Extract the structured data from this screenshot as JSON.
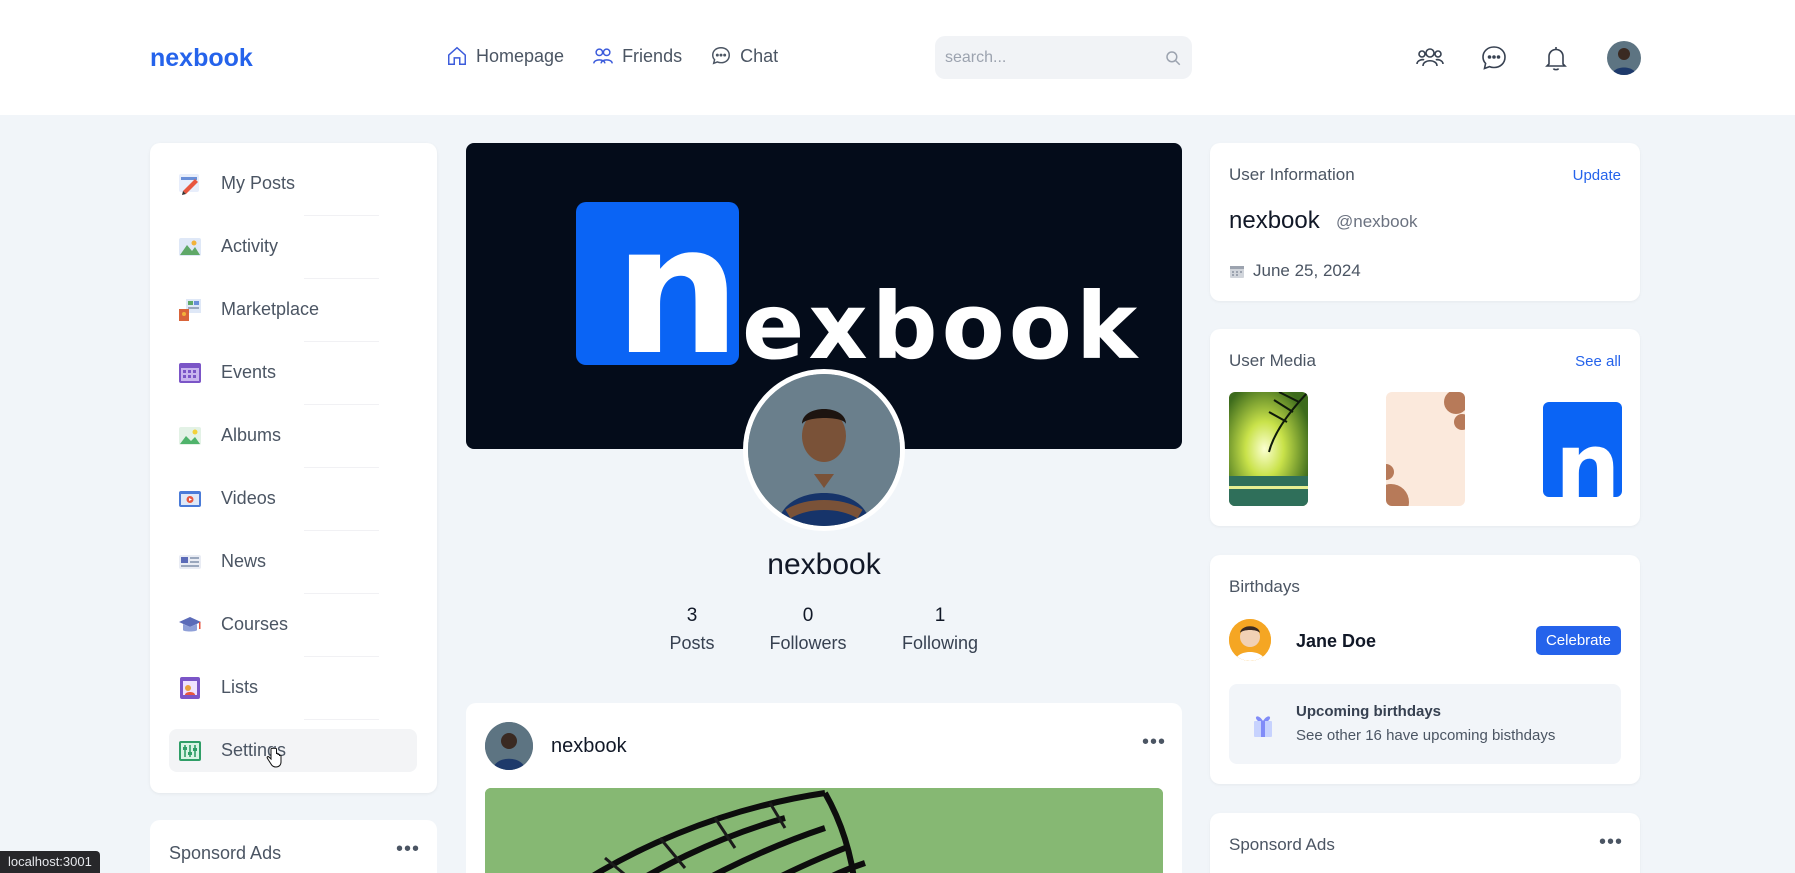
{
  "header": {
    "logo": "nexbook",
    "nav": [
      {
        "label": "Homepage",
        "icon": "home-icon"
      },
      {
        "label": "Friends",
        "icon": "friends-icon"
      },
      {
        "label": "Chat",
        "icon": "chat-icon"
      }
    ],
    "search_placeholder": "search...",
    "icons": [
      "people-icon",
      "message-icon",
      "bell-icon"
    ]
  },
  "sidebar": {
    "items": [
      {
        "label": "My Posts",
        "icon": "my-posts-icon"
      },
      {
        "label": "Activity",
        "icon": "activity-icon"
      },
      {
        "label": "Marketplace",
        "icon": "marketplace-icon"
      },
      {
        "label": "Events",
        "icon": "events-icon"
      },
      {
        "label": "Albums",
        "icon": "albums-icon"
      },
      {
        "label": "Videos",
        "icon": "videos-icon"
      },
      {
        "label": "News",
        "icon": "news-icon"
      },
      {
        "label": "Courses",
        "icon": "courses-icon"
      },
      {
        "label": "Lists",
        "icon": "lists-icon"
      },
      {
        "label": "Settings",
        "icon": "settings-icon",
        "active": true
      }
    ],
    "ads_title": "Sponsord Ads"
  },
  "profile": {
    "cover_text_n": "n",
    "cover_text_rest": "exbook",
    "name": "nexbook",
    "stats": [
      {
        "num": "3",
        "label": "Posts"
      },
      {
        "num": "0",
        "label": "Followers"
      },
      {
        "num": "1",
        "label": "Following"
      }
    ]
  },
  "post": {
    "author": "nexbook"
  },
  "user_info": {
    "title": "User Information",
    "update": "Update",
    "name": "nexbook",
    "handle": "@nexbook",
    "date": "June 25, 2024"
  },
  "user_media": {
    "title": "User Media",
    "see_all": "See all"
  },
  "birthdays": {
    "title": "Birthdays",
    "name": "Jane Doe",
    "celebrate": "Celebrate",
    "upcoming_title": "Upcoming birthdays",
    "upcoming_text": "See other 16 have upcoming bisthdays"
  },
  "ads_right": {
    "title": "Sponsord Ads"
  },
  "status_bar": "localhost:3001",
  "colors": {
    "brand": "#2563eb",
    "background": "#f1f5f9",
    "cover": "#040c1a",
    "cover_logo_box": "#0a64f5"
  }
}
